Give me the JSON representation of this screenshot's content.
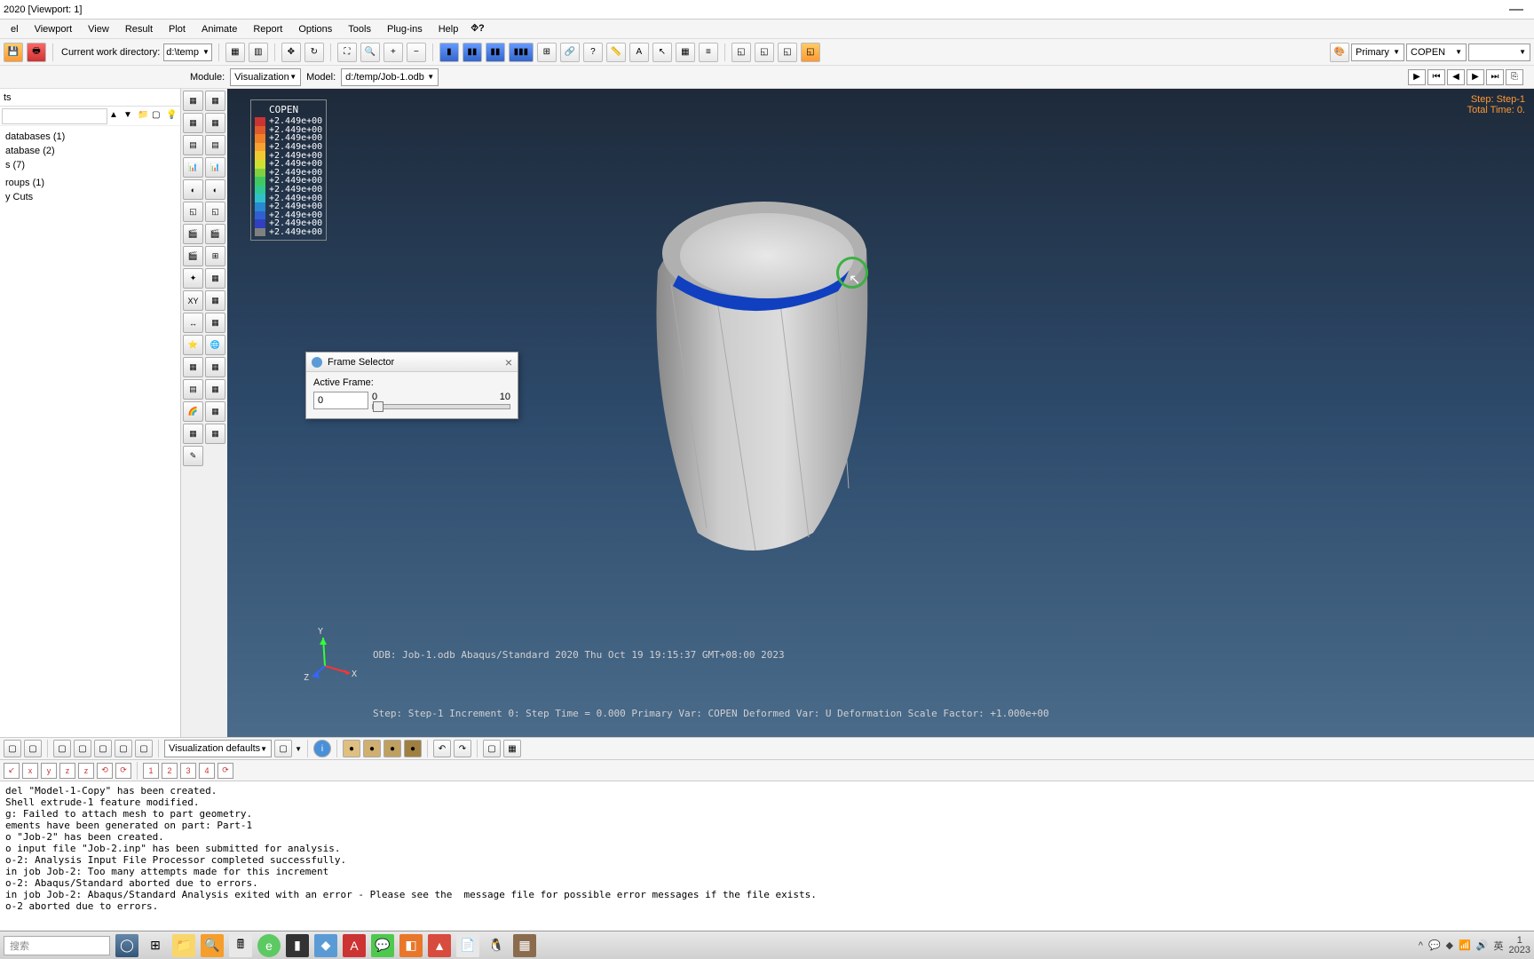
{
  "titlebar": {
    "title": "2020 [Viewport: 1]"
  },
  "menubar": {
    "items": [
      "el",
      "Viewport",
      "View",
      "Result",
      "Plot",
      "Animate",
      "Report",
      "Options",
      "Tools",
      "Plug-ins",
      "Help"
    ],
    "qmark": "⯑?"
  },
  "toolbar1": {
    "wd_label": "Current work directory:",
    "wd_value": "d:\\temp",
    "primary_label": "Primary",
    "copen_label": "COPEN"
  },
  "modulebar": {
    "module_label": "Module:",
    "module_value": "Visualization",
    "model_label": "Model:",
    "model_value": "d:/temp/Job-1.odb"
  },
  "tree": {
    "header": "ts",
    "items": [
      "databases (1)",
      "atabase (2)",
      "s (7)",
      "",
      "roups (1)",
      "y Cuts"
    ]
  },
  "legend": {
    "title": "COPEN",
    "values": [
      "+2.449e+00",
      "+2.449e+00",
      "+2.449e+00",
      "+2.449e+00",
      "+2.449e+00",
      "+2.449e+00",
      "+2.449e+00",
      "+2.449e+00",
      "+2.449e+00",
      "+2.449e+00",
      "+2.449e+00",
      "+2.449e+00",
      "+2.449e+00",
      "+2.449e+00"
    ],
    "colors": [
      "#cc3333",
      "#e05a2b",
      "#f08028",
      "#f8a030",
      "#f0c830",
      "#d0e030",
      "#80d040",
      "#40c860",
      "#30c890",
      "#30c0c8",
      "#2888d0",
      "#3060d0",
      "#3040c0",
      "#808080"
    ]
  },
  "overlay_tr": {
    "line1": "Step: Step-1",
    "line2": "Total Time: 0."
  },
  "frame_dlg": {
    "title": "Frame Selector",
    "active_label": "Active Frame:",
    "value": "0",
    "min": "0",
    "max": "10"
  },
  "triad": {
    "x": "X",
    "y": "Y",
    "z": "Z"
  },
  "odb_line": "ODB: Job-1.odb    Abaqus/Standard 2020    Thu Oct 19 19:15:37 GMT+08:00 2023",
  "step_lines": "Step: Step-1\nIncrement      0: Step Time =    0.000\nPrimary Var: COPEN\nDeformed Var: U   Deformation Scale Factor: +1.000e+00",
  "btoolbar1": {
    "vis_defaults": "Visualization defaults"
  },
  "btoolbar2": {
    "nums": [
      "1",
      "2",
      "3",
      "4"
    ]
  },
  "msg_log": "del \"Model-1-Copy\" has been created.\nShell extrude-1 feature modified.\ng: Failed to attach mesh to part geometry.\nements have been generated on part: Part-1\no \"Job-2\" has been created.\no input file \"Job-2.inp\" has been submitted for analysis.\no-2: Analysis Input File Processor completed successfully.\nin job Job-2: Too many attempts made for this increment\no-2: Abaqus/Standard aborted due to errors.\nin job Job-2: Abaqus/Standard Analysis exited with an error - Please see the  message file for possible error messages if the file exists.\no-2 aborted due to errors.",
  "taskbar": {
    "search_placeholder": "搜索",
    "tray_ime": "英",
    "tray_time": "1",
    "tray_date": "2023"
  }
}
